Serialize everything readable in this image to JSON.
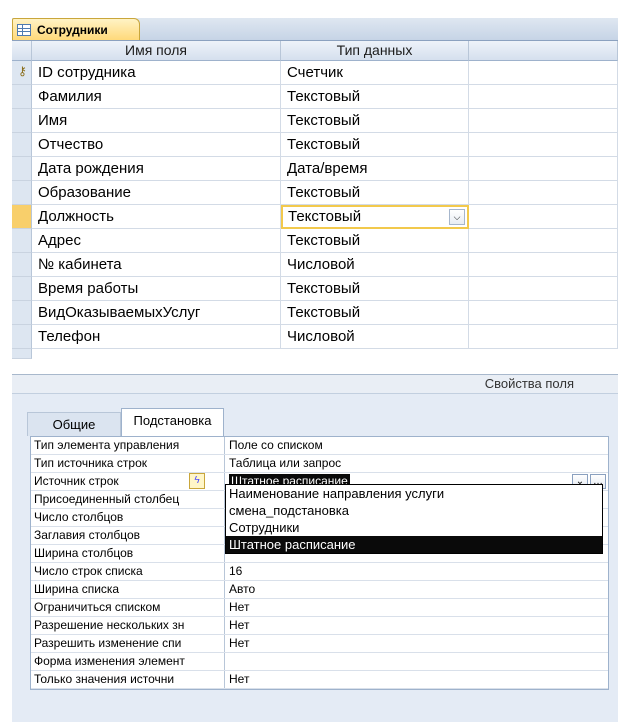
{
  "document_tab": {
    "title": "Сотрудники",
    "icon": "table-icon"
  },
  "grid": {
    "headers": {
      "field_name": "Имя поля",
      "data_type": "Тип данных",
      "description": ""
    },
    "rows": [
      {
        "name": "ID сотрудника",
        "type": "Счетчик",
        "key": true
      },
      {
        "name": "Фамилия",
        "type": "Текстовый"
      },
      {
        "name": "Имя",
        "type": "Текстовый"
      },
      {
        "name": "Отчество",
        "type": "Текстовый"
      },
      {
        "name": "Дата рождения",
        "type": "Дата/время"
      },
      {
        "name": "Образование",
        "type": "Текстовый"
      },
      {
        "name": "Должность",
        "type": "Текстовый",
        "active": true
      },
      {
        "name": "Адрес",
        "type": "Текстовый"
      },
      {
        "name": "№ кабинета",
        "type": "Числовой"
      },
      {
        "name": "Время работы",
        "type": "Текстовый"
      },
      {
        "name": "ВидОказываемыхУслуг",
        "type": "Текстовый"
      },
      {
        "name": "Телефон",
        "type": "Числовой"
      }
    ]
  },
  "field_properties": {
    "title": "Свойства поля",
    "tabs": {
      "general": "Общие",
      "lookup": "Подстановка"
    },
    "rows": [
      {
        "label": "Тип элемента управления",
        "value": "Поле со списком"
      },
      {
        "label": "Тип источника строк",
        "value": "Таблица или запрос"
      },
      {
        "label": "Источник строк",
        "value": "Штатное расписание"
      },
      {
        "label": "Присоединенный столбец",
        "value": ""
      },
      {
        "label": "Число столбцов",
        "value": ""
      },
      {
        "label": "Заглавия столбцов",
        "value": ""
      },
      {
        "label": "Ширина столбцов",
        "value": ""
      },
      {
        "label": "Число строк списка",
        "value": "16"
      },
      {
        "label": "Ширина списка",
        "value": "Авто"
      },
      {
        "label": "Ограничиться списком",
        "value": "Нет"
      },
      {
        "label": "Разрешение нескольких зн",
        "value": "Нет"
      },
      {
        "label": "Разрешить изменение спи",
        "value": "Нет"
      },
      {
        "label": "Форма изменения элемент",
        "value": ""
      },
      {
        "label": "Только значения источни",
        "value": "Нет"
      }
    ],
    "dropdown": {
      "items": [
        "Наименование направления услуги",
        "смена_подстановка",
        "Сотрудники",
        "Штатное расписание"
      ],
      "selected": "Штатное расписание"
    }
  }
}
